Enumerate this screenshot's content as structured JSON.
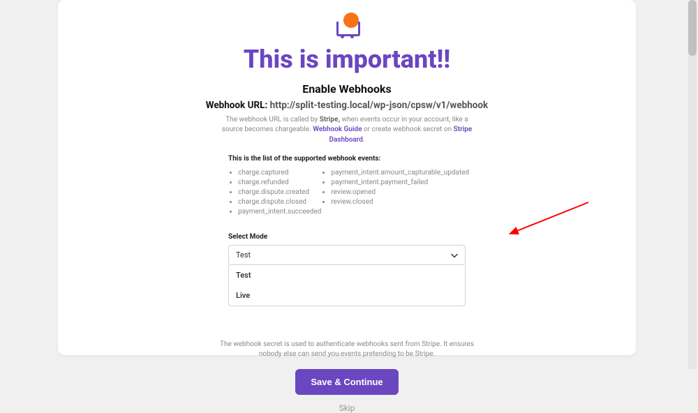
{
  "title": "This is important!!",
  "subtitle": "Enable Webhooks",
  "webhook": {
    "label": "Webhook URL:",
    "url": "http://split-testing.local/wp-json/cpsw/v1/webhook"
  },
  "desc": {
    "p1": "The webhook URL is called by ",
    "stripe": "Stripe,",
    "p2": " when events occur in your account, like a source becomes chargeable. ",
    "link1": "Webhook Guide",
    "p3": " or create webhook secret on ",
    "link2": "Stripe Dashboard",
    "p4": "."
  },
  "events_title": "This is the list of the supported webhook events:",
  "events_left": [
    "charge.captured",
    "charge.refunded",
    "charge.dispute.created",
    "charge.dispute.closed",
    "payment_intent.succeeded"
  ],
  "events_right": [
    "payment_intent.amount_capturable_updated",
    "payment_intent.payment_failed",
    "review.opened",
    "review.closed"
  ],
  "mode": {
    "label": "Select Mode",
    "selected": "Test",
    "options": [
      "Test",
      "Live"
    ]
  },
  "note": "The webhook secret is used to authenticate webhooks sent from Stripe. It ensures nobody else can send you events pretending to be Stripe.",
  "buttons": {
    "save": "Save & Continue",
    "skip": "Skip"
  }
}
